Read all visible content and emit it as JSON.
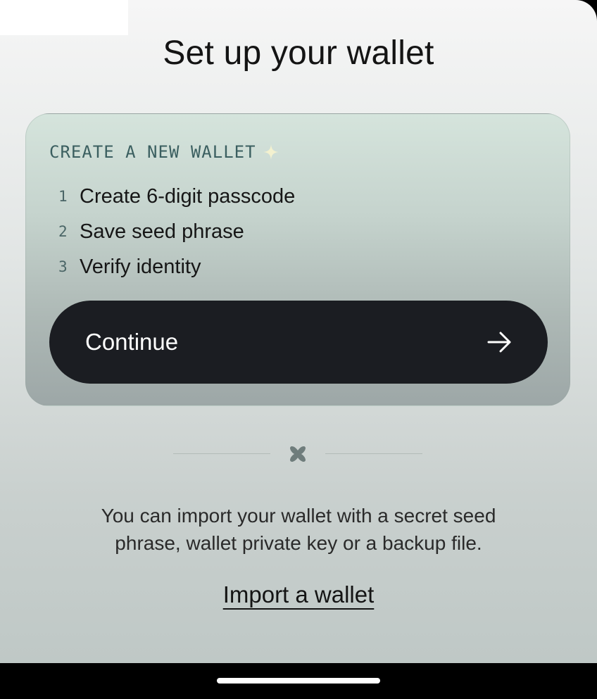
{
  "page": {
    "title": "Set up your wallet"
  },
  "create_card": {
    "heading": "CREATE A NEW WALLET",
    "heading_icon": "sparkle-icon",
    "steps": [
      {
        "number": "1",
        "label": "Create 6-digit passcode"
      },
      {
        "number": "2",
        "label": "Save seed phrase"
      },
      {
        "number": "3",
        "label": "Verify identity"
      }
    ],
    "continue_label": "Continue",
    "continue_icon": "arrow-right-icon"
  },
  "divider": {
    "icon": "flower-icon"
  },
  "import": {
    "description": "You can import your wallet with a secret seed phrase, wallet private key or a backup file.",
    "link_label": "Import a wallet"
  },
  "colors": {
    "button_bg": "#1b1d22",
    "heading_teal": "#3b5f60",
    "sparkle": "#f3f1cf"
  }
}
